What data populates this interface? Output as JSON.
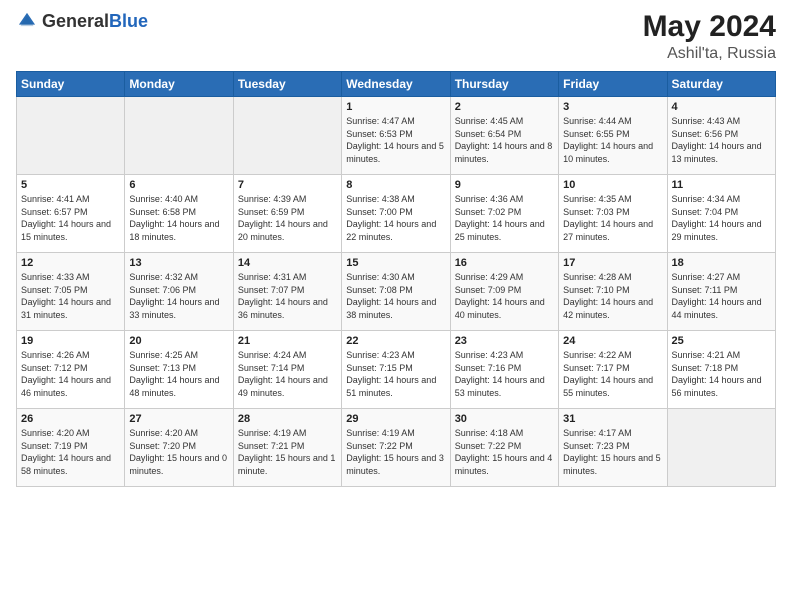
{
  "header": {
    "logo_general": "General",
    "logo_blue": "Blue",
    "month": "May 2024",
    "location": "Ashil'ta, Russia"
  },
  "days_of_week": [
    "Sunday",
    "Monday",
    "Tuesday",
    "Wednesday",
    "Thursday",
    "Friday",
    "Saturday"
  ],
  "weeks": [
    [
      {
        "day": "",
        "sunrise": "",
        "sunset": "",
        "daylight": ""
      },
      {
        "day": "",
        "sunrise": "",
        "sunset": "",
        "daylight": ""
      },
      {
        "day": "",
        "sunrise": "",
        "sunset": "",
        "daylight": ""
      },
      {
        "day": "1",
        "sunrise": "Sunrise: 4:47 AM",
        "sunset": "Sunset: 6:53 PM",
        "daylight": "Daylight: 14 hours and 5 minutes."
      },
      {
        "day": "2",
        "sunrise": "Sunrise: 4:45 AM",
        "sunset": "Sunset: 6:54 PM",
        "daylight": "Daylight: 14 hours and 8 minutes."
      },
      {
        "day": "3",
        "sunrise": "Sunrise: 4:44 AM",
        "sunset": "Sunset: 6:55 PM",
        "daylight": "Daylight: 14 hours and 10 minutes."
      },
      {
        "day": "4",
        "sunrise": "Sunrise: 4:43 AM",
        "sunset": "Sunset: 6:56 PM",
        "daylight": "Daylight: 14 hours and 13 minutes."
      }
    ],
    [
      {
        "day": "5",
        "sunrise": "Sunrise: 4:41 AM",
        "sunset": "Sunset: 6:57 PM",
        "daylight": "Daylight: 14 hours and 15 minutes."
      },
      {
        "day": "6",
        "sunrise": "Sunrise: 4:40 AM",
        "sunset": "Sunset: 6:58 PM",
        "daylight": "Daylight: 14 hours and 18 minutes."
      },
      {
        "day": "7",
        "sunrise": "Sunrise: 4:39 AM",
        "sunset": "Sunset: 6:59 PM",
        "daylight": "Daylight: 14 hours and 20 minutes."
      },
      {
        "day": "8",
        "sunrise": "Sunrise: 4:38 AM",
        "sunset": "Sunset: 7:00 PM",
        "daylight": "Daylight: 14 hours and 22 minutes."
      },
      {
        "day": "9",
        "sunrise": "Sunrise: 4:36 AM",
        "sunset": "Sunset: 7:02 PM",
        "daylight": "Daylight: 14 hours and 25 minutes."
      },
      {
        "day": "10",
        "sunrise": "Sunrise: 4:35 AM",
        "sunset": "Sunset: 7:03 PM",
        "daylight": "Daylight: 14 hours and 27 minutes."
      },
      {
        "day": "11",
        "sunrise": "Sunrise: 4:34 AM",
        "sunset": "Sunset: 7:04 PM",
        "daylight": "Daylight: 14 hours and 29 minutes."
      }
    ],
    [
      {
        "day": "12",
        "sunrise": "Sunrise: 4:33 AM",
        "sunset": "Sunset: 7:05 PM",
        "daylight": "Daylight: 14 hours and 31 minutes."
      },
      {
        "day": "13",
        "sunrise": "Sunrise: 4:32 AM",
        "sunset": "Sunset: 7:06 PM",
        "daylight": "Daylight: 14 hours and 33 minutes."
      },
      {
        "day": "14",
        "sunrise": "Sunrise: 4:31 AM",
        "sunset": "Sunset: 7:07 PM",
        "daylight": "Daylight: 14 hours and 36 minutes."
      },
      {
        "day": "15",
        "sunrise": "Sunrise: 4:30 AM",
        "sunset": "Sunset: 7:08 PM",
        "daylight": "Daylight: 14 hours and 38 minutes."
      },
      {
        "day": "16",
        "sunrise": "Sunrise: 4:29 AM",
        "sunset": "Sunset: 7:09 PM",
        "daylight": "Daylight: 14 hours and 40 minutes."
      },
      {
        "day": "17",
        "sunrise": "Sunrise: 4:28 AM",
        "sunset": "Sunset: 7:10 PM",
        "daylight": "Daylight: 14 hours and 42 minutes."
      },
      {
        "day": "18",
        "sunrise": "Sunrise: 4:27 AM",
        "sunset": "Sunset: 7:11 PM",
        "daylight": "Daylight: 14 hours and 44 minutes."
      }
    ],
    [
      {
        "day": "19",
        "sunrise": "Sunrise: 4:26 AM",
        "sunset": "Sunset: 7:12 PM",
        "daylight": "Daylight: 14 hours and 46 minutes."
      },
      {
        "day": "20",
        "sunrise": "Sunrise: 4:25 AM",
        "sunset": "Sunset: 7:13 PM",
        "daylight": "Daylight: 14 hours and 48 minutes."
      },
      {
        "day": "21",
        "sunrise": "Sunrise: 4:24 AM",
        "sunset": "Sunset: 7:14 PM",
        "daylight": "Daylight: 14 hours and 49 minutes."
      },
      {
        "day": "22",
        "sunrise": "Sunrise: 4:23 AM",
        "sunset": "Sunset: 7:15 PM",
        "daylight": "Daylight: 14 hours and 51 minutes."
      },
      {
        "day": "23",
        "sunrise": "Sunrise: 4:23 AM",
        "sunset": "Sunset: 7:16 PM",
        "daylight": "Daylight: 14 hours and 53 minutes."
      },
      {
        "day": "24",
        "sunrise": "Sunrise: 4:22 AM",
        "sunset": "Sunset: 7:17 PM",
        "daylight": "Daylight: 14 hours and 55 minutes."
      },
      {
        "day": "25",
        "sunrise": "Sunrise: 4:21 AM",
        "sunset": "Sunset: 7:18 PM",
        "daylight": "Daylight: 14 hours and 56 minutes."
      }
    ],
    [
      {
        "day": "26",
        "sunrise": "Sunrise: 4:20 AM",
        "sunset": "Sunset: 7:19 PM",
        "daylight": "Daylight: 14 hours and 58 minutes."
      },
      {
        "day": "27",
        "sunrise": "Sunrise: 4:20 AM",
        "sunset": "Sunset: 7:20 PM",
        "daylight": "Daylight: 15 hours and 0 minutes."
      },
      {
        "day": "28",
        "sunrise": "Sunrise: 4:19 AM",
        "sunset": "Sunset: 7:21 PM",
        "daylight": "Daylight: 15 hours and 1 minute."
      },
      {
        "day": "29",
        "sunrise": "Sunrise: 4:19 AM",
        "sunset": "Sunset: 7:22 PM",
        "daylight": "Daylight: 15 hours and 3 minutes."
      },
      {
        "day": "30",
        "sunrise": "Sunrise: 4:18 AM",
        "sunset": "Sunset: 7:22 PM",
        "daylight": "Daylight: 15 hours and 4 minutes."
      },
      {
        "day": "31",
        "sunrise": "Sunrise: 4:17 AM",
        "sunset": "Sunset: 7:23 PM",
        "daylight": "Daylight: 15 hours and 5 minutes."
      },
      {
        "day": "",
        "sunrise": "",
        "sunset": "",
        "daylight": ""
      }
    ]
  ]
}
